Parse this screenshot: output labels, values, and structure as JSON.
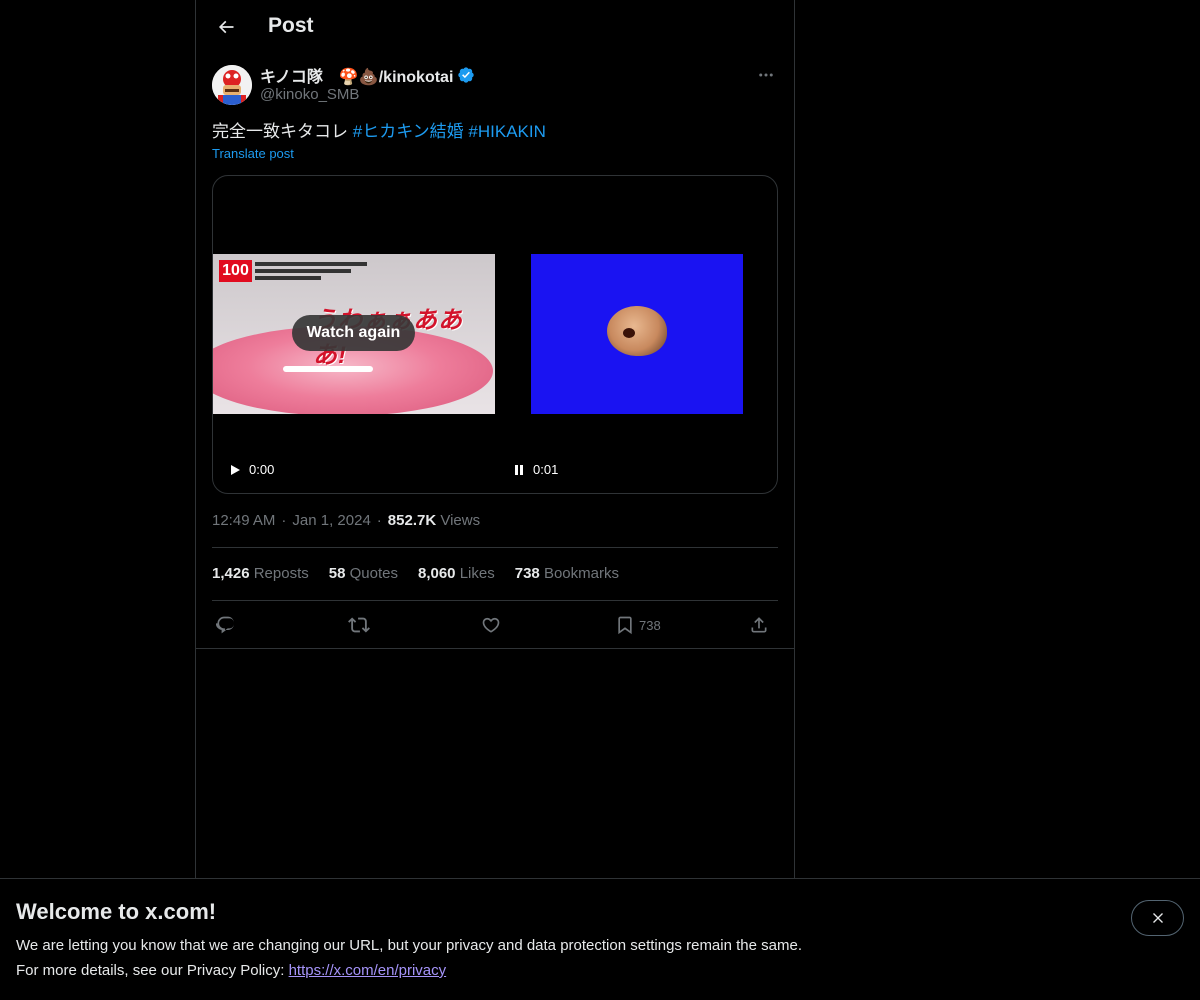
{
  "header": {
    "title": "Post"
  },
  "author": {
    "display_name": "キノコ隊　🍄💩/kinokotai",
    "handle": "@kinoko_SMB",
    "verified": true
  },
  "tweet": {
    "text": "完全一致キタコレ ",
    "hashtags": [
      "#ヒカキン結婚",
      "#HIKAKIN"
    ],
    "translate_label": "Translate post"
  },
  "media": {
    "watch_again_label": "Watch again",
    "left_badge": "100",
    "left_caption": "うわぁぁあああ!",
    "left_time": "0:00",
    "right_time": "0:01"
  },
  "meta": {
    "time": "12:49 AM",
    "date": "Jan 1, 2024",
    "views_count": "852.7K",
    "views_label": "Views"
  },
  "stats": {
    "reposts_count": "1,426",
    "reposts_label": "Reposts",
    "quotes_count": "58",
    "quotes_label": "Quotes",
    "likes_count": "8,060",
    "likes_label": "Likes",
    "bookmarks_count": "738",
    "bookmarks_label": "Bookmarks"
  },
  "actions": {
    "bookmark_count": "738"
  },
  "banner": {
    "title": "Welcome to x.com!",
    "line1": "We are letting you know that we are changing our URL, but your privacy and data protection settings remain the same.",
    "line2_prefix": "For more details, see our Privacy Policy: ",
    "link": "https://x.com/en/privacy"
  },
  "colors": {
    "accent": "#1d9bf0",
    "background": "#000000",
    "muted": "#71767b",
    "text": "#e7e9ea"
  },
  "icons": [
    "back-arrow-icon",
    "verified-badge-icon",
    "more-icon",
    "play-icon",
    "pause-icon",
    "reply-icon",
    "repost-icon",
    "like-icon",
    "bookmark-icon",
    "share-icon",
    "close-icon"
  ]
}
